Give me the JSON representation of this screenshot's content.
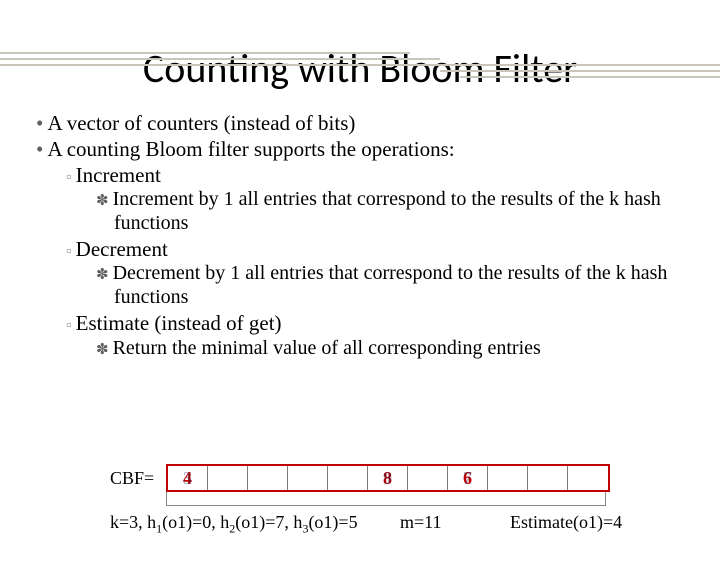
{
  "title": "Counting with Bloom Filter",
  "bullets": {
    "b1a": "A vector of counters (instead of bits)",
    "b1b": "A counting Bloom filter supports the operations:",
    "b2a": "Increment",
    "b3a": "Increment by 1 all entries that correspond to the results of the k hash functions",
    "b2b": "Decrement",
    "b3b": "Decrement by 1 all entries that correspond to the results of the k hash functions",
    "b2c": "Estimate (instead of get)",
    "b3c": "Return the minimal value of all corresponding entries"
  },
  "diagram": {
    "label": "CBF=",
    "cells": [
      "4",
      "",
      "",
      "",
      "",
      "8",
      "",
      "6",
      "",
      "",
      ""
    ],
    "overlay": {
      "0": "3",
      "5": "9",
      "7": "7"
    },
    "hash_line": "k=3, h₁(o1)=0, h₂(o1)=7, h₃(o1)=5",
    "m_label": "m=11",
    "estimate": "Estimate(o1)=4"
  }
}
